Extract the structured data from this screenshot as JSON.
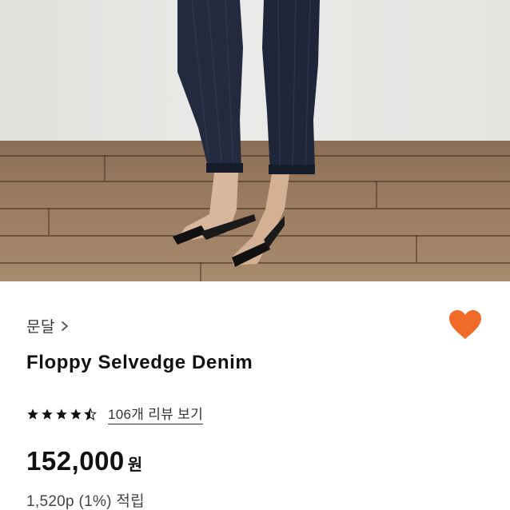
{
  "product_image": {
    "alt_description": "product-photo"
  },
  "brand": {
    "name": "문달"
  },
  "product": {
    "title": "Floppy Selvedge Denim"
  },
  "rating": {
    "stars": 4.5,
    "reviews_label": "106개 리뷰 보기"
  },
  "price": {
    "amount": "152,000",
    "currency": "원"
  },
  "points": {
    "label": "1,520p (1%) 적립"
  },
  "colors": {
    "heart": "#f06a2a",
    "star": "#111111"
  },
  "icons": {
    "wishlist": "heart-icon",
    "brand_link": "chevron-right-icon",
    "rating": "star-icon"
  }
}
